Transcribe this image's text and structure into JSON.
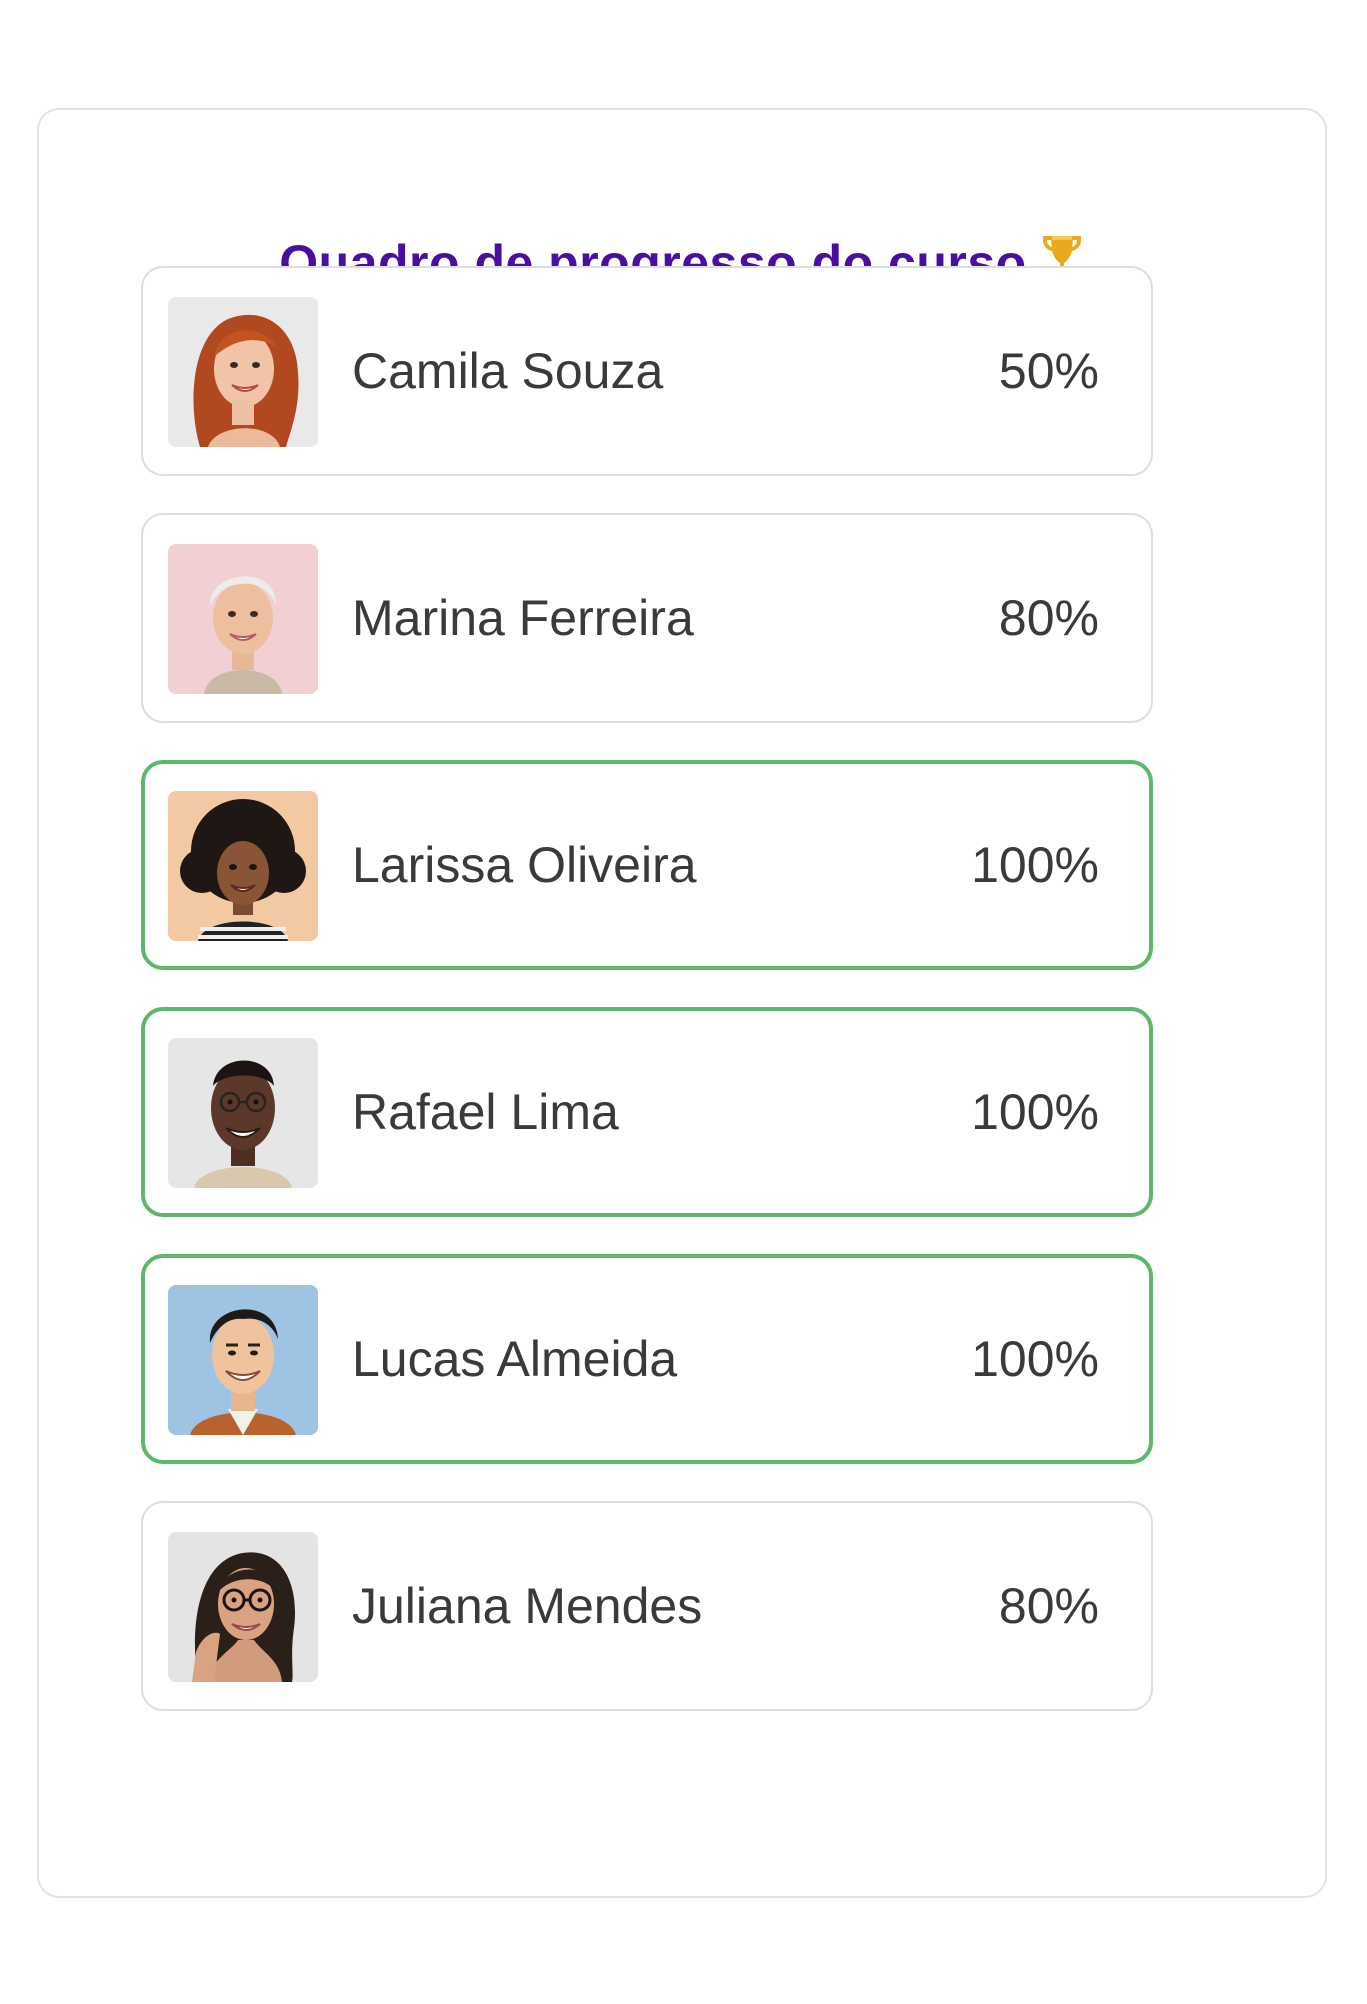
{
  "board": {
    "title": "Quadro de progresso do curso",
    "title_icon": "trophy-icon"
  },
  "colors": {
    "title": "#4a0f9e",
    "complete_border": "#5cb86a",
    "default_border": "#dedede"
  },
  "students": [
    {
      "name": "Camila Souza",
      "progress": "50%",
      "avatar_bg": "#e9e9e9",
      "complete": false
    },
    {
      "name": "Marina Ferreira",
      "progress": "80%",
      "avatar_bg": "#f1cfd2",
      "complete": false
    },
    {
      "name": "Larissa Oliveira",
      "progress": "100%",
      "avatar_bg": "#f3c9a3",
      "complete": true
    },
    {
      "name": "Rafael Lima",
      "progress": "100%",
      "avatar_bg": "#e6e6e6",
      "complete": true
    },
    {
      "name": "Lucas Almeida",
      "progress": "100%",
      "avatar_bg": "#9ec3e3",
      "complete": true
    },
    {
      "name": "Juliana Mendes",
      "progress": "80%",
      "avatar_bg": "#e4e4e4",
      "complete": false
    }
  ]
}
